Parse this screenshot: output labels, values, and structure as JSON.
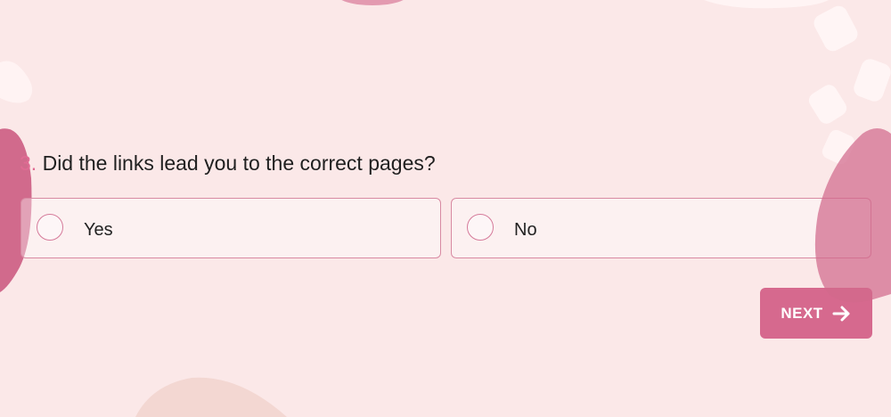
{
  "question": {
    "number": "3.",
    "text": " Did the links lead you to the correct pages?"
  },
  "options": [
    {
      "label": "Yes",
      "selected": false
    },
    {
      "label": "No",
      "selected": false
    }
  ],
  "next_button": {
    "label": "NEXT",
    "icon": "arrow-right-icon"
  },
  "colors": {
    "background": "#fbe8e8",
    "accent": "#d6698e",
    "option_border": "#d88aa2"
  }
}
